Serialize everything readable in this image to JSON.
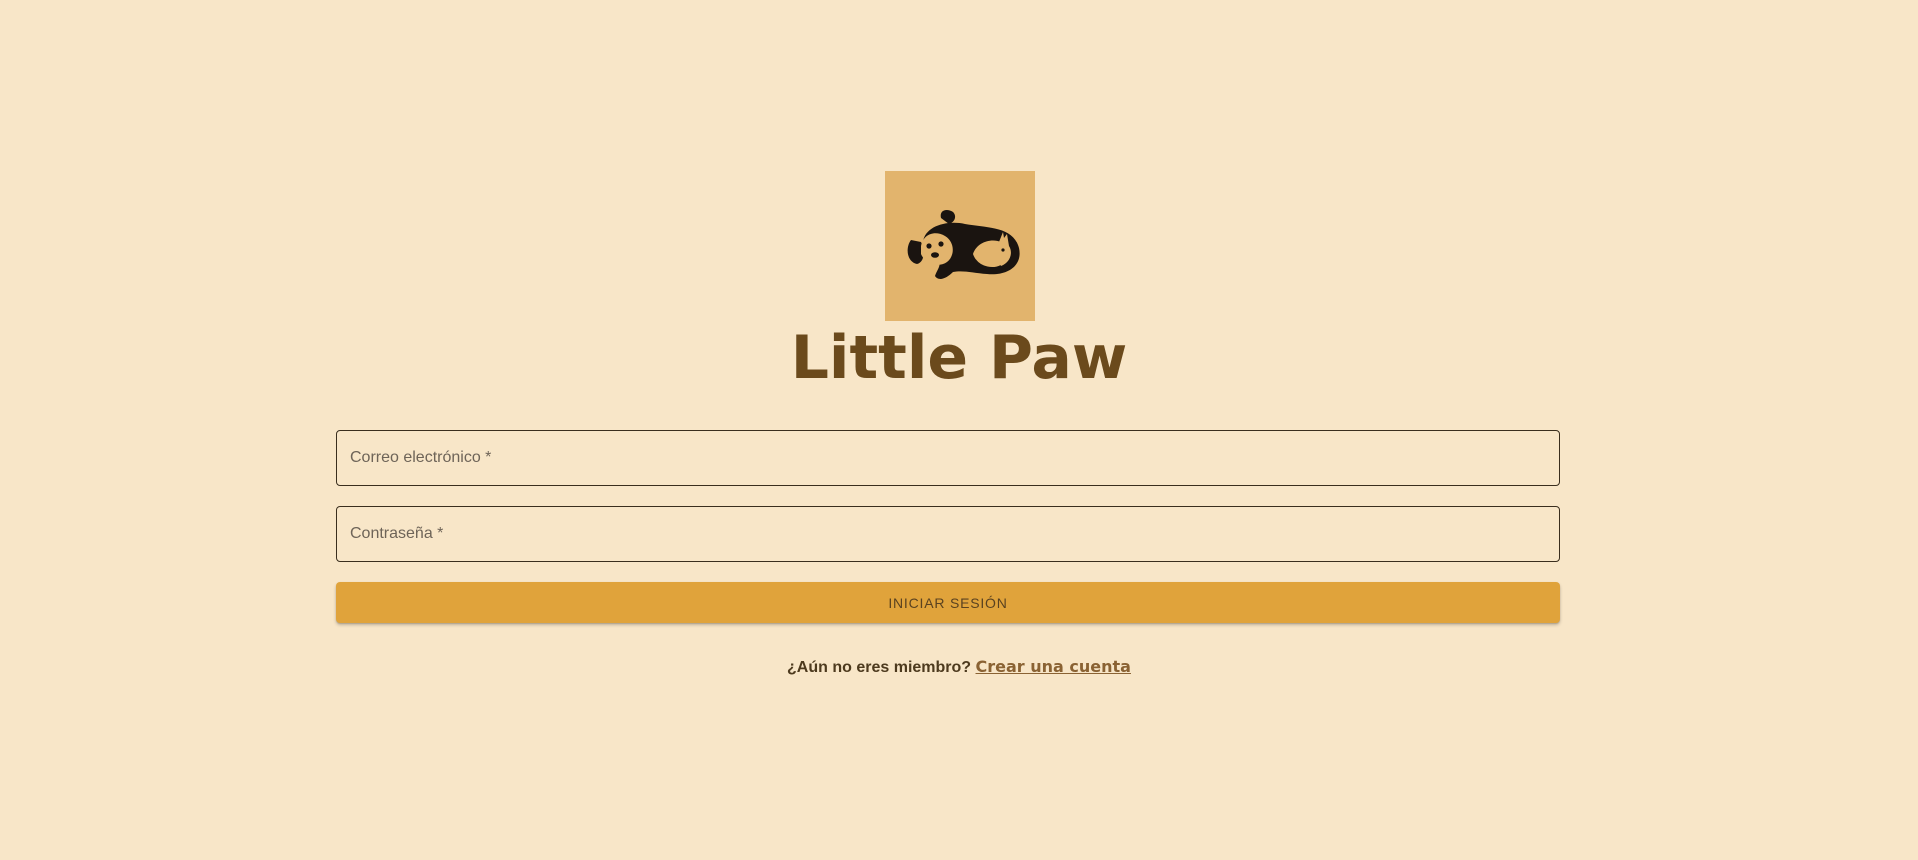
{
  "brand": {
    "logo_icon": "dog-and-cat-logo-icon",
    "title": "Little Paw"
  },
  "form": {
    "email_label": "Correo electrónico *",
    "email_value": "",
    "password_label": "Contraseña *",
    "password_value": "",
    "submit_label": "INICIAR SESIÓN"
  },
  "signup": {
    "question": "¿Aún no eres miembro?",
    "link_label": "Crear una cuenta"
  },
  "colors": {
    "background": "#f8e6c8",
    "logo_background": "#e2b46d",
    "title": "#6b4a1c",
    "button": "#e0a33b",
    "link": "#8a6233"
  }
}
